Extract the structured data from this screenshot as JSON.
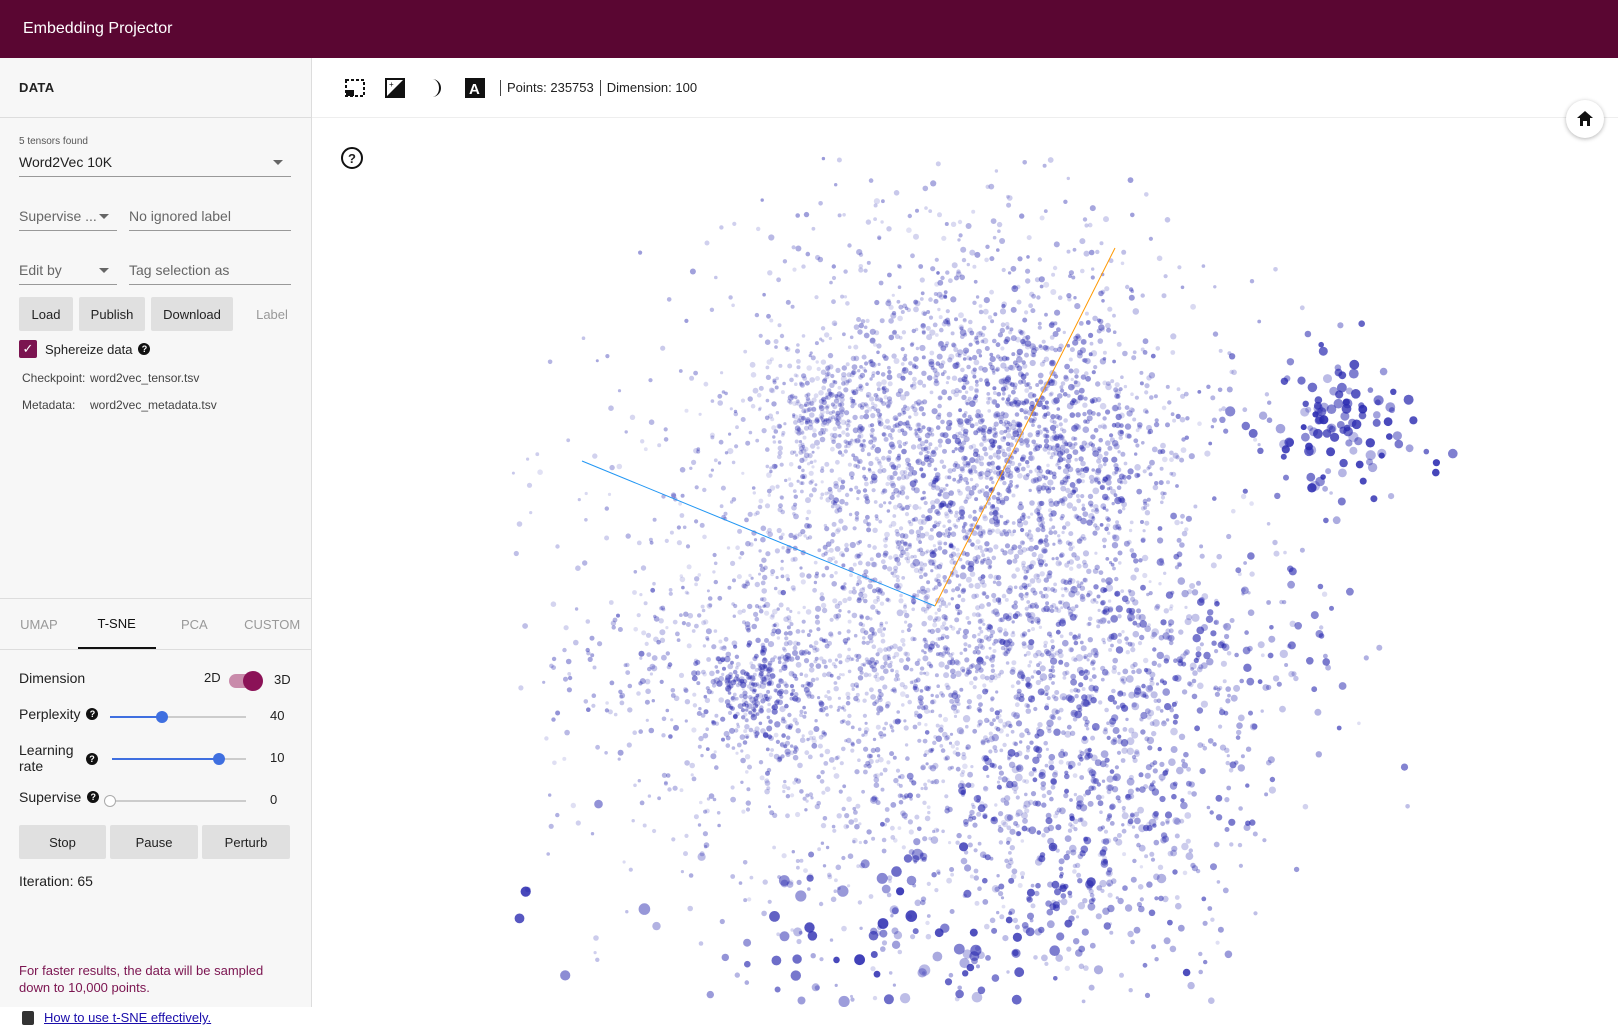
{
  "app": {
    "title": "Embedding Projector"
  },
  "data_panel": {
    "header": "DATA",
    "tensors_found": "5 tensors found",
    "tensor_selected": "Word2Vec 10K",
    "supervise_select": "Supervise ...",
    "ignored_label_placeholder": "No ignored label",
    "edit_by_select": "Edit by",
    "tag_selection_placeholder": "Tag selection as",
    "buttons": {
      "load": "Load",
      "publish": "Publish",
      "download": "Download",
      "label": "Label"
    },
    "sphereize": {
      "label": "Sphereize data",
      "checked": true
    },
    "checkpoint": {
      "key": "Checkpoint:",
      "value": "word2vec_tensor.tsv"
    },
    "metadata": {
      "key": "Metadata:",
      "value": "word2vec_metadata.tsv"
    }
  },
  "projection_tabs": [
    "UMAP",
    "T-SNE",
    "PCA",
    "CUSTOM"
  ],
  "active_tab": "T-SNE",
  "tsne": {
    "dimension": {
      "label": "Dimension",
      "left": "2D",
      "right": "3D",
      "is_3d": true
    },
    "perplexity": {
      "label": "Perplexity",
      "value": "40",
      "fraction": 0.38
    },
    "learning_rate": {
      "label_line1": "Learning",
      "label_line2": "rate",
      "value": "10",
      "fraction": 0.8
    },
    "supervise": {
      "label": "Supervise",
      "value": "0",
      "fraction": 0.0
    },
    "buttons": {
      "stop": "Stop",
      "pause": "Pause",
      "perturb": "Perturb"
    },
    "iteration": "Iteration: 65",
    "warning": "For faster results, the data will be sampled down to 10,000 points.",
    "help_link": "How to use t-SNE effectively."
  },
  "toolbar": {
    "points": "Points: 235753",
    "dimension": "Dimension: 100",
    "icons": [
      "select-box-icon",
      "night-mode-icon",
      "moon-icon",
      "label-icon"
    ]
  },
  "colors": {
    "brand": "#5a0632",
    "accent": "#7b1450",
    "points": "#2a2ab0",
    "axis_x": "#2196f3",
    "axis_y": "#ff9800"
  }
}
